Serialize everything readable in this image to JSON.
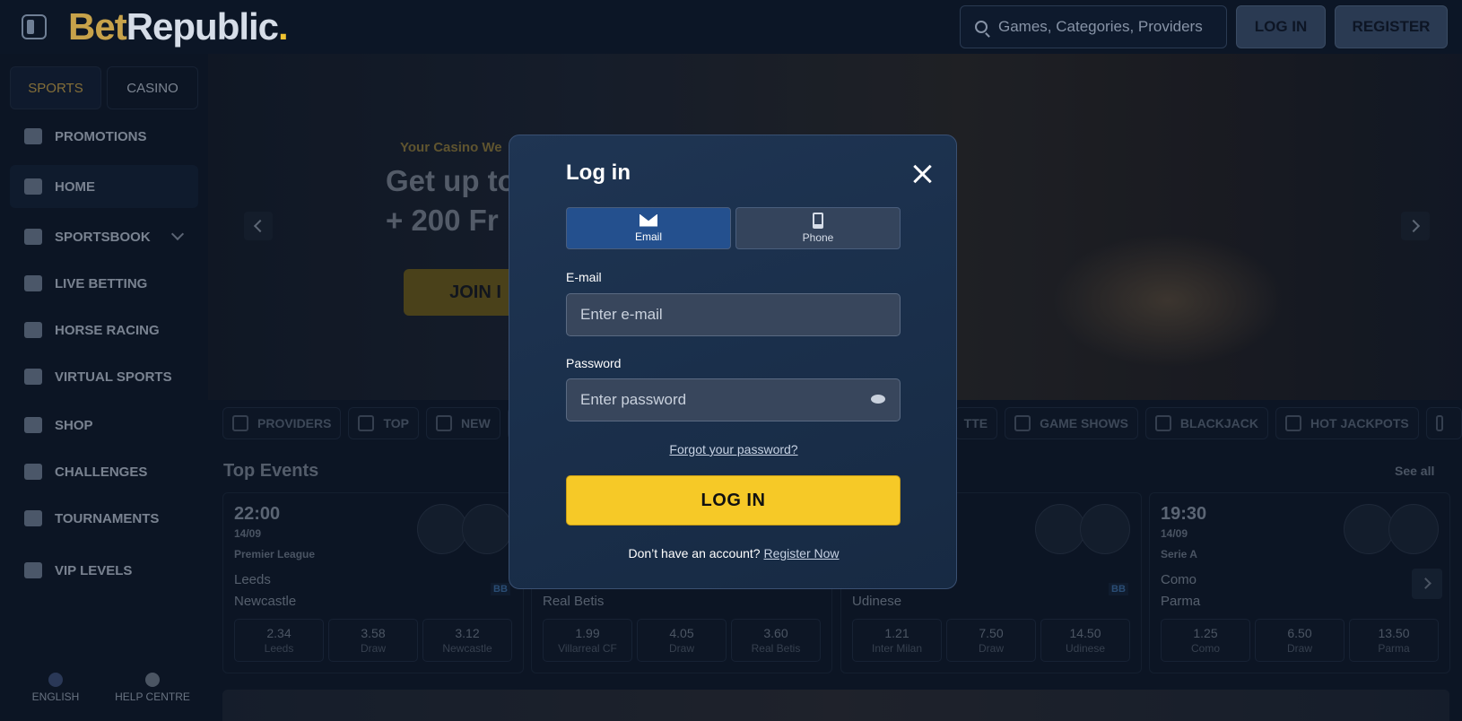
{
  "header": {
    "logo_bet": "Bet",
    "logo_republic": "Republic",
    "logo_dot": ".",
    "search_placeholder": "Games, Categories, Providers",
    "login_label": "LOG IN",
    "register_label": "REGISTER"
  },
  "sidebar": {
    "tabs": [
      "SPORTS",
      "CASINO"
    ],
    "items": [
      {
        "label": "PROMOTIONS",
        "icon": "gift-icon"
      },
      {
        "label": "HOME",
        "icon": "home-icon"
      },
      {
        "label": "SPORTSBOOK",
        "icon": "ball-icon"
      },
      {
        "label": "LIVE BETTING",
        "icon": "live-icon"
      },
      {
        "label": "HORSE RACING",
        "icon": "horse-icon"
      },
      {
        "label": "VIRTUAL SPORTS",
        "icon": "virtual-icon"
      },
      {
        "label": "SHOP",
        "icon": "basket-icon"
      },
      {
        "label": "CHALLENGES",
        "icon": "challenge-icon"
      },
      {
        "label": "TOURNAMENTS",
        "icon": "podium-icon"
      },
      {
        "label": "VIP LEVELS",
        "icon": "diamond-icon"
      }
    ],
    "language": "ENGLISH",
    "help": "HELP CENTRE"
  },
  "hero": {
    "subtitle": "Your Casino We",
    "title_line1": "Get up to",
    "title_line2": "+ 200 Fr",
    "join_label": "JOIN I"
  },
  "categories": [
    "PROVIDERS",
    "TOP",
    "NEW",
    "TTE",
    "GAME SHOWS",
    "BLACKJACK",
    "HOT JACKPOTS"
  ],
  "top_events": {
    "title": "Top Events",
    "see_all": "See all",
    "events": [
      {
        "time": "22:00",
        "date": "14/09",
        "league": "Premier League",
        "team1": "Leeds",
        "team2": "Newcastle",
        "odds": [
          {
            "v": "2.34",
            "l": "Leeds"
          },
          {
            "v": "3.58",
            "l": "Draw"
          },
          {
            "v": "3.12",
            "l": "Newcastle"
          }
        ]
      },
      {
        "time": "",
        "date": "",
        "league": "",
        "team1": "",
        "team2": "Real Betis",
        "odds": [
          {
            "v": "1.99",
            "l": "Villarreal CF"
          },
          {
            "v": "4.05",
            "l": "Draw"
          },
          {
            "v": "3.60",
            "l": "Real Betis"
          }
        ]
      },
      {
        "time": "",
        "date": "",
        "league": "",
        "team1": "",
        "team2": "Udinese",
        "odds": [
          {
            "v": "1.21",
            "l": "Inter Milan"
          },
          {
            "v": "7.50",
            "l": "Draw"
          },
          {
            "v": "14.50",
            "l": "Udinese"
          }
        ]
      },
      {
        "time": "19:30",
        "date": "14/09",
        "league": "Serie A",
        "team1": "Como",
        "team2": "Parma",
        "odds": [
          {
            "v": "1.25",
            "l": "Como"
          },
          {
            "v": "6.50",
            "l": "Draw"
          },
          {
            "v": "13.50",
            "l": "Parma"
          }
        ]
      }
    ],
    "bb_label": "BB"
  },
  "modal": {
    "title": "Log in",
    "tab_email": "Email",
    "tab_phone": "Phone",
    "email_label": "E-mail",
    "email_placeholder": "Enter e-mail",
    "password_label": "Password",
    "password_placeholder": "Enter password",
    "forgot": "Forgot your password?",
    "login_button": "LOG IN",
    "no_account": "Don’t have an account?",
    "register_link": "Register Now"
  }
}
